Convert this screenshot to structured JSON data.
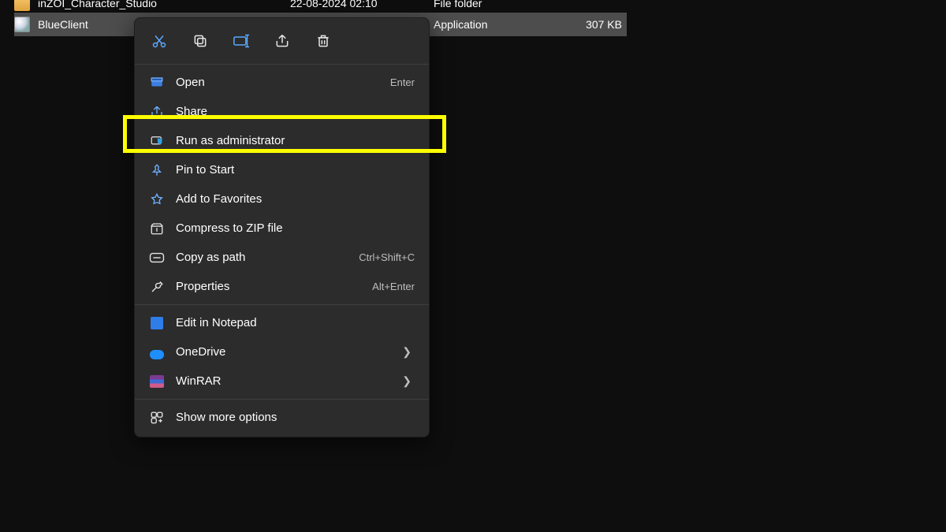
{
  "files": [
    {
      "name": "inZOI_Character_Studio",
      "date": "22-08-2024 02:10",
      "type": "File folder",
      "size": ""
    },
    {
      "name": "BlueClient",
      "date": "",
      "type": "Application",
      "size": "307 KB"
    }
  ],
  "topbar_icons": [
    "cut",
    "copy",
    "rename",
    "share",
    "delete"
  ],
  "menu": {
    "open": {
      "label": "Open",
      "shortcut": "Enter"
    },
    "share": {
      "label": "Share",
      "shortcut": ""
    },
    "run_admin": {
      "label": "Run as administrator",
      "shortcut": ""
    },
    "pin_start": {
      "label": "Pin to Start",
      "shortcut": ""
    },
    "favorites": {
      "label": "Add to Favorites",
      "shortcut": ""
    },
    "compress_zip": {
      "label": "Compress to ZIP file",
      "shortcut": ""
    },
    "copy_path": {
      "label": "Copy as path",
      "shortcut": "Ctrl+Shift+C"
    },
    "properties": {
      "label": "Properties",
      "shortcut": "Alt+Enter"
    },
    "edit_notepad": {
      "label": "Edit in Notepad",
      "shortcut": ""
    },
    "onedrive": {
      "label": "OneDrive",
      "shortcut": "",
      "submenu": true
    },
    "winrar": {
      "label": "WinRAR",
      "shortcut": "",
      "submenu": true
    },
    "show_more": {
      "label": "Show more options",
      "shortcut": ""
    }
  },
  "highlighted_item": "run_admin"
}
